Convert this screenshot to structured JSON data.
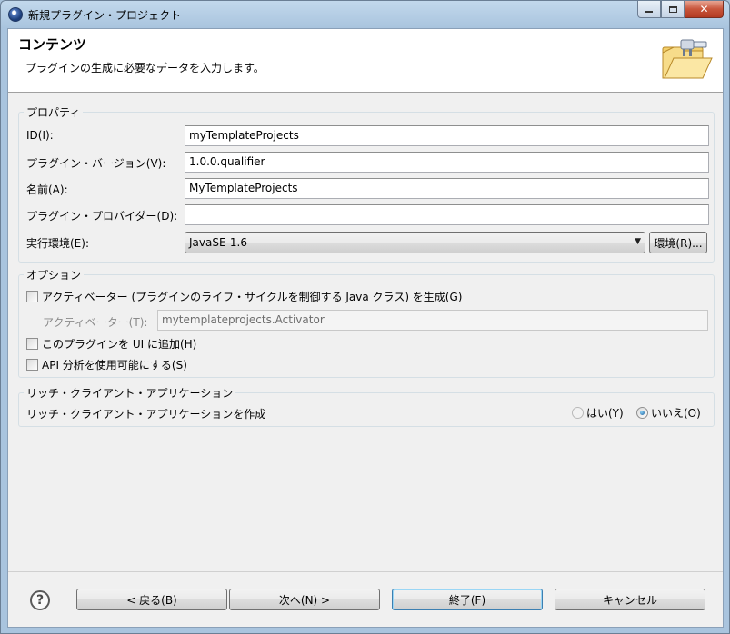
{
  "window": {
    "title": "新規プラグイン・プロジェクト"
  },
  "header": {
    "title": "コンテンツ",
    "description": "プラグインの生成に必要なデータを入力します。",
    "icon": "folder-plugin-icon"
  },
  "properties": {
    "group_title": "プロパティ",
    "id_label": "ID(I):",
    "id_value": "myTemplateProjects",
    "version_label": "プラグイン・バージョン(V):",
    "version_value": "1.0.0.qualifier",
    "name_label": "名前(A):",
    "name_value": "MyTemplateProjects",
    "provider_label": "プラグイン・プロバイダー(D):",
    "provider_value": "",
    "env_label": "実行環境(E):",
    "env_value": "JavaSE-1.6",
    "env_button": "環境(R)..."
  },
  "options": {
    "group_title": "オプション",
    "activator_check": "アクティベーター (プラグインのライフ・サイクルを制御する Java クラス) を生成(G)",
    "activator_label": "アクティベーター(T):",
    "activator_value": "mytemplateprojects.Activator",
    "ui_check": "このプラグインを UI に追加(H)",
    "api_check": "API 分析を使用可能にする(S)"
  },
  "rcp": {
    "group_title": "リッチ・クライアント・アプリケーション",
    "question": "リッチ・クライアント・アプリケーションを作成",
    "yes": "はい(Y)",
    "no": "いいえ(O)",
    "selected": "no"
  },
  "footer": {
    "back": "< 戻る(B)",
    "next": "次へ(N) >",
    "finish": "終了(F)",
    "cancel": "キャンセル",
    "help_icon": "help-icon"
  }
}
